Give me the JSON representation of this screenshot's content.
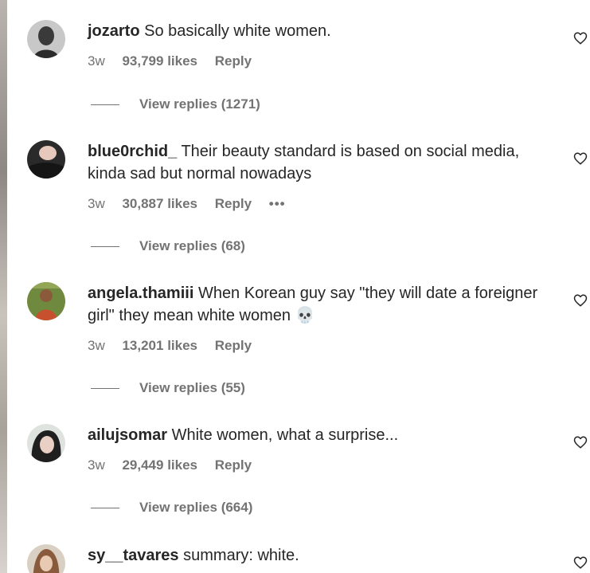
{
  "comments": [
    {
      "username": "jozarto",
      "text": "So basically white women.",
      "time": "3w",
      "likes": "93,799 likes",
      "reply": "Reply",
      "more": "",
      "view_replies": "View replies (1271)"
    },
    {
      "username": "blue0rchid_",
      "text": "Their beauty standard is based on social media, kinda sad but normal nowadays",
      "time": "3w",
      "likes": "30,887 likes",
      "reply": "Reply",
      "more": "•••",
      "view_replies": "View replies (68)"
    },
    {
      "username": "angela.thamiii",
      "text": "When Korean guy say \"they will date a foreigner girl\" they mean white women 💀",
      "time": "3w",
      "likes": "13,201 likes",
      "reply": "Reply",
      "more": "",
      "view_replies": "View replies (55)"
    },
    {
      "username": "ailujsomar",
      "text": "White women, what a surprise...",
      "time": "3w",
      "likes": "29,449 likes",
      "reply": "Reply",
      "more": "",
      "view_replies": "View replies (664)"
    },
    {
      "username": "sy__tavares",
      "text": "summary: white.",
      "time": "",
      "likes": "",
      "reply": "",
      "more": "",
      "view_replies": ""
    }
  ],
  "icons": {
    "heart": "heart-outline-icon",
    "more": "more-options-icon"
  },
  "colors": {
    "text": "#262626",
    "secondary": "#737373",
    "background": "#ffffff"
  }
}
